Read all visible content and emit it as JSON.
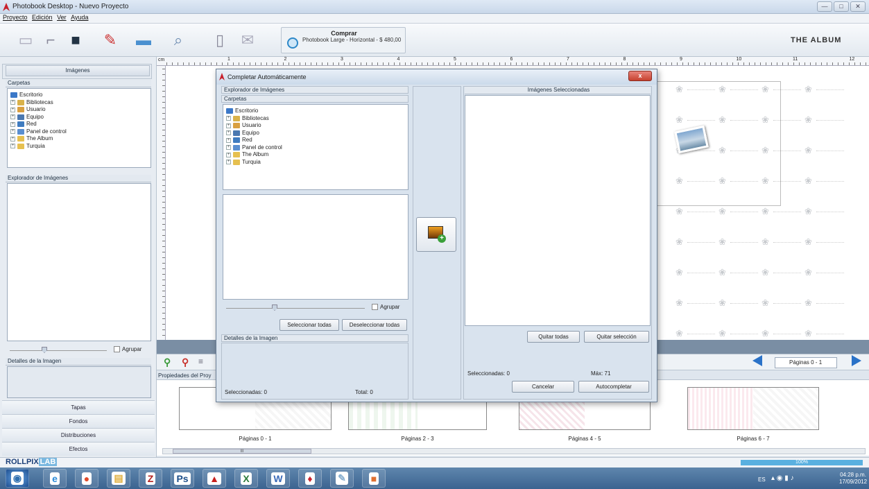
{
  "window": {
    "title": "Photobook Desktop - Nuevo Proyecto",
    "min": "—",
    "max": "□",
    "close": "✕"
  },
  "menu": [
    "Proyecto",
    "Edición",
    "Ver",
    "Ayuda"
  ],
  "toolbar": {
    "comprar_title": "Comprar",
    "comprar_subtitle": "Photobook Large - Horizontal - $ 480,00",
    "brand": "THE ALBUM"
  },
  "ruler": {
    "unit": "cm",
    "ticks": [
      "1",
      "2",
      "3",
      "4",
      "5",
      "6",
      "7",
      "8",
      "9",
      "10",
      "11",
      "12"
    ]
  },
  "left_panel": {
    "images_tab": "Imágenes",
    "carpetas": "Carpetas",
    "tree": [
      {
        "label": "Escritorio",
        "icon": "desktop-icon",
        "color": "#3b78c8",
        "root": true
      },
      {
        "label": "Bibliotecas",
        "icon": "library-icon",
        "color": "#d9b24a"
      },
      {
        "label": "Usuario",
        "icon": "user-icon",
        "color": "#d9a040"
      },
      {
        "label": "Equipo",
        "icon": "computer-icon",
        "color": "#4a78b0"
      },
      {
        "label": "Red",
        "icon": "network-icon",
        "color": "#3f7cc0"
      },
      {
        "label": "Panel de control",
        "icon": "control-panel-icon",
        "color": "#5a8fd0"
      },
      {
        "label": "The Album",
        "icon": "folder-icon",
        "color": "#e6c050"
      },
      {
        "label": "Turquia",
        "icon": "folder-icon",
        "color": "#e6c050"
      }
    ],
    "explorer": "Explorador de Imágenes",
    "agrupar": "Agrupar",
    "details": "Detalles de la Imagen",
    "nav": [
      "Tapas",
      "Fondos",
      "Distribuciones",
      "Efectos"
    ]
  },
  "workspace": {
    "props_label": "Propiedades del Proy",
    "page_selector": "Páginas 0 - 1",
    "thumbs": [
      "Páginas 0 - 1",
      "Páginas 2 - 3",
      "Páginas 4 - 5",
      "Páginas 6 - 7"
    ],
    "hscroll_mark": "III"
  },
  "dialog": {
    "title": "Completar Automáticamente",
    "close": "x",
    "explorer": "Explorador de Imágenes",
    "carpetas": "Carpetas",
    "agrupar": "Agrupar",
    "select_all": "Seleccionar todas",
    "deselect_all": "Deseleccionar todas",
    "details": "Detalles de la Imagen",
    "selected_count": "Seleccionadas: 0",
    "total": "Total: 0",
    "selected_images": "Imágenes Seleccionadas",
    "remove_all": "Quitar todas",
    "remove_selection": "Quitar selección",
    "selected_right": "Seleccionadas: 0",
    "max": "Máx: 71",
    "cancel": "Cancelar",
    "autocomplete": "Autocompletar"
  },
  "status": {
    "brand": "ROLLPIX",
    "brand_suffix": "LAB",
    "progress": "100%",
    "progress_value": 1.0
  },
  "taskbar": {
    "lang": "ES",
    "time": "04:28 p.m.",
    "date": "17/09/2012",
    "apps": [
      {
        "name": "start-button",
        "glyph": "◉",
        "color": "#2f6fb0"
      },
      {
        "name": "ie-icon",
        "glyph": "e",
        "color": "#2a8ad8"
      },
      {
        "name": "chrome-icon",
        "glyph": "●",
        "color": "#e04a2a"
      },
      {
        "name": "explorer-icon",
        "glyph": "▤",
        "color": "#e0b040"
      },
      {
        "name": "filezilla-icon",
        "glyph": "Z",
        "color": "#b3201e"
      },
      {
        "name": "photoshop-icon",
        "glyph": "Ps",
        "color": "#1d4f8a"
      },
      {
        "name": "acrobat-icon",
        "glyph": "▲",
        "color": "#c8201e"
      },
      {
        "name": "excel-icon",
        "glyph": "X",
        "color": "#2a7a3a"
      },
      {
        "name": "word-icon",
        "glyph": "W",
        "color": "#3a6ab8"
      },
      {
        "name": "photobook-icon",
        "glyph": "♦",
        "color": "#c8202c"
      },
      {
        "name": "tool-icon",
        "glyph": "✎",
        "color": "#8ab0d0"
      },
      {
        "name": "app-icon",
        "glyph": "■",
        "color": "#e07030"
      }
    ]
  }
}
